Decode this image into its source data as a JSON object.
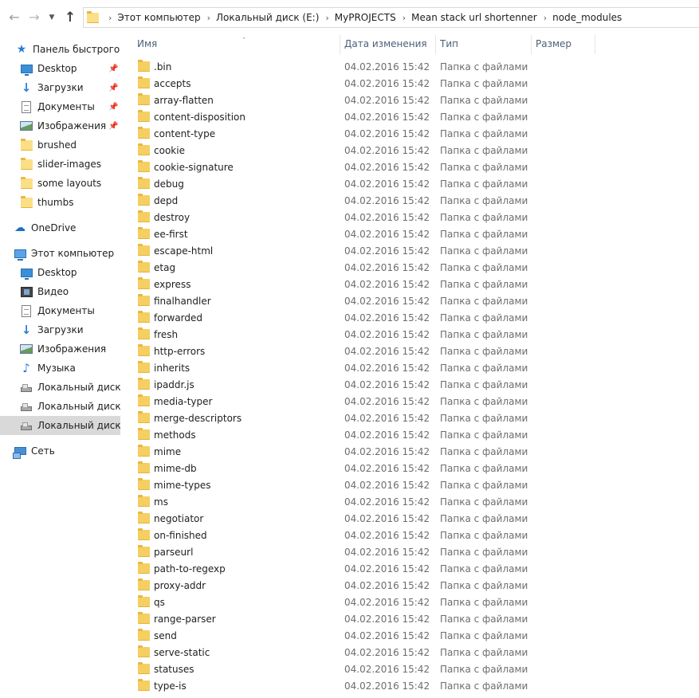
{
  "address_bar": {
    "path": [
      "Этот компьютер",
      "Локальный диск (E:)",
      "MyPROJECTS",
      "Mean stack url shortenner",
      "node_modules"
    ]
  },
  "nav_pane": {
    "quick_access_label": "Панель быстрого доступа",
    "quick_access_items": [
      {
        "label": "Desktop",
        "icon": "desktop-icon",
        "pinned": true
      },
      {
        "label": "Загрузки",
        "icon": "downloads-icon",
        "pinned": true
      },
      {
        "label": "Документы",
        "icon": "documents-icon",
        "pinned": true
      },
      {
        "label": "Изображения",
        "icon": "pictures-icon",
        "pinned": true
      },
      {
        "label": "brushed",
        "icon": "folder-icon",
        "pinned": false
      },
      {
        "label": "slider-images",
        "icon": "folder-icon",
        "pinned": false
      },
      {
        "label": "some layouts",
        "icon": "folder-icon",
        "pinned": false
      },
      {
        "label": "thumbs",
        "icon": "folder-icon",
        "pinned": false
      }
    ],
    "onedrive_label": "OneDrive",
    "this_pc_label": "Этот компьютер",
    "this_pc_items": [
      {
        "label": "Desktop",
        "icon": "desktop-icon"
      },
      {
        "label": "Видео",
        "icon": "videos-icon"
      },
      {
        "label": "Документы",
        "icon": "documents-icon"
      },
      {
        "label": "Загрузки",
        "icon": "downloads-icon"
      },
      {
        "label": "Изображения",
        "icon": "pictures-icon"
      },
      {
        "label": "Музыка",
        "icon": "music-icon"
      },
      {
        "label": "Локальный диск (C:)",
        "icon": "drive-icon"
      },
      {
        "label": "Локальный диск (D:)",
        "icon": "drive-icon"
      },
      {
        "label": "Локальный диск (E:)",
        "icon": "drive-icon",
        "selected": true
      }
    ],
    "network_label": "Сеть"
  },
  "columns": {
    "name": "Имя",
    "date": "Дата изменения",
    "type": "Тип",
    "size": "Размер"
  },
  "files": [
    {
      "name": ".bin",
      "date": "04.02.2016 15:42",
      "type": "Папка с файлами"
    },
    {
      "name": "accepts",
      "date": "04.02.2016 15:42",
      "type": "Папка с файлами"
    },
    {
      "name": "array-flatten",
      "date": "04.02.2016 15:42",
      "type": "Папка с файлами"
    },
    {
      "name": "content-disposition",
      "date": "04.02.2016 15:42",
      "type": "Папка с файлами"
    },
    {
      "name": "content-type",
      "date": "04.02.2016 15:42",
      "type": "Папка с файлами"
    },
    {
      "name": "cookie",
      "date": "04.02.2016 15:42",
      "type": "Папка с файлами"
    },
    {
      "name": "cookie-signature",
      "date": "04.02.2016 15:42",
      "type": "Папка с файлами"
    },
    {
      "name": "debug",
      "date": "04.02.2016 15:42",
      "type": "Папка с файлами"
    },
    {
      "name": "depd",
      "date": "04.02.2016 15:42",
      "type": "Папка с файлами"
    },
    {
      "name": "destroy",
      "date": "04.02.2016 15:42",
      "type": "Папка с файлами"
    },
    {
      "name": "ee-first",
      "date": "04.02.2016 15:42",
      "type": "Папка с файлами"
    },
    {
      "name": "escape-html",
      "date": "04.02.2016 15:42",
      "type": "Папка с файлами"
    },
    {
      "name": "etag",
      "date": "04.02.2016 15:42",
      "type": "Папка с файлами"
    },
    {
      "name": "express",
      "date": "04.02.2016 15:42",
      "type": "Папка с файлами"
    },
    {
      "name": "finalhandler",
      "date": "04.02.2016 15:42",
      "type": "Папка с файлами"
    },
    {
      "name": "forwarded",
      "date": "04.02.2016 15:42",
      "type": "Папка с файлами"
    },
    {
      "name": "fresh",
      "date": "04.02.2016 15:42",
      "type": "Папка с файлами"
    },
    {
      "name": "http-errors",
      "date": "04.02.2016 15:42",
      "type": "Папка с файлами"
    },
    {
      "name": "inherits",
      "date": "04.02.2016 15:42",
      "type": "Папка с файлами"
    },
    {
      "name": "ipaddr.js",
      "date": "04.02.2016 15:42",
      "type": "Папка с файлами"
    },
    {
      "name": "media-typer",
      "date": "04.02.2016 15:42",
      "type": "Папка с файлами"
    },
    {
      "name": "merge-descriptors",
      "date": "04.02.2016 15:42",
      "type": "Папка с файлами"
    },
    {
      "name": "methods",
      "date": "04.02.2016 15:42",
      "type": "Папка с файлами"
    },
    {
      "name": "mime",
      "date": "04.02.2016 15:42",
      "type": "Папка с файлами"
    },
    {
      "name": "mime-db",
      "date": "04.02.2016 15:42",
      "type": "Папка с файлами"
    },
    {
      "name": "mime-types",
      "date": "04.02.2016 15:42",
      "type": "Папка с файлами"
    },
    {
      "name": "ms",
      "date": "04.02.2016 15:42",
      "type": "Папка с файлами"
    },
    {
      "name": "negotiator",
      "date": "04.02.2016 15:42",
      "type": "Папка с файлами"
    },
    {
      "name": "on-finished",
      "date": "04.02.2016 15:42",
      "type": "Папка с файлами"
    },
    {
      "name": "parseurl",
      "date": "04.02.2016 15:42",
      "type": "Папка с файлами"
    },
    {
      "name": "path-to-regexp",
      "date": "04.02.2016 15:42",
      "type": "Папка с файлами"
    },
    {
      "name": "proxy-addr",
      "date": "04.02.2016 15:42",
      "type": "Папка с файлами"
    },
    {
      "name": "qs",
      "date": "04.02.2016 15:42",
      "type": "Папка с файлами"
    },
    {
      "name": "range-parser",
      "date": "04.02.2016 15:42",
      "type": "Папка с файлами"
    },
    {
      "name": "send",
      "date": "04.02.2016 15:42",
      "type": "Папка с файлами"
    },
    {
      "name": "serve-static",
      "date": "04.02.2016 15:42",
      "type": "Папка с файлами"
    },
    {
      "name": "statuses",
      "date": "04.02.2016 15:42",
      "type": "Папка с файлами"
    },
    {
      "name": "type-is",
      "date": "04.02.2016 15:42",
      "type": "Папка с файлами"
    }
  ],
  "colors": {
    "selection": "#d9d9d9",
    "folder": "#f5cf62",
    "header_text": "#4c607a",
    "secondary_text": "#6d6d6d"
  }
}
